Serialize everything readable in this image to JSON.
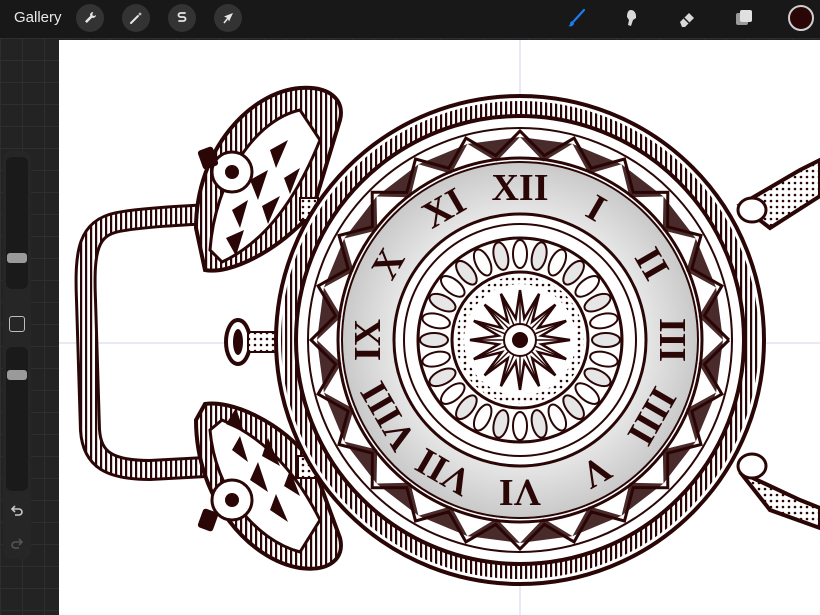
{
  "toolbar": {
    "gallery_label": "Gallery",
    "actions_icon": "wrench-icon",
    "adjustments_icon": "magic-wand-icon",
    "selection_icon": "s-selection-icon",
    "transform_icon": "arrow-cursor-icon",
    "brush_icon": "brush-icon",
    "smudge_icon": "smudge-icon",
    "eraser_icon": "eraser-icon",
    "layers_icon": "layers-icon",
    "active_tool": "brush",
    "current_color": "#2a0606",
    "accent_color": "#1e7bf2"
  },
  "sidebar": {
    "brush_size": 0.22,
    "brush_opacity": 0.85,
    "modify_icon": "square-icon",
    "undo_icon": "undo-arrow-icon",
    "redo_icon": "redo-arrow-icon"
  },
  "drawing": {
    "subject": "mandala alarm clock",
    "numerals": [
      "XII",
      "I",
      "II",
      "III",
      "IIII",
      "V",
      "VI",
      "VII",
      "VIII",
      "IX",
      "X",
      "XI"
    ],
    "ink_color": "#2a0606"
  }
}
